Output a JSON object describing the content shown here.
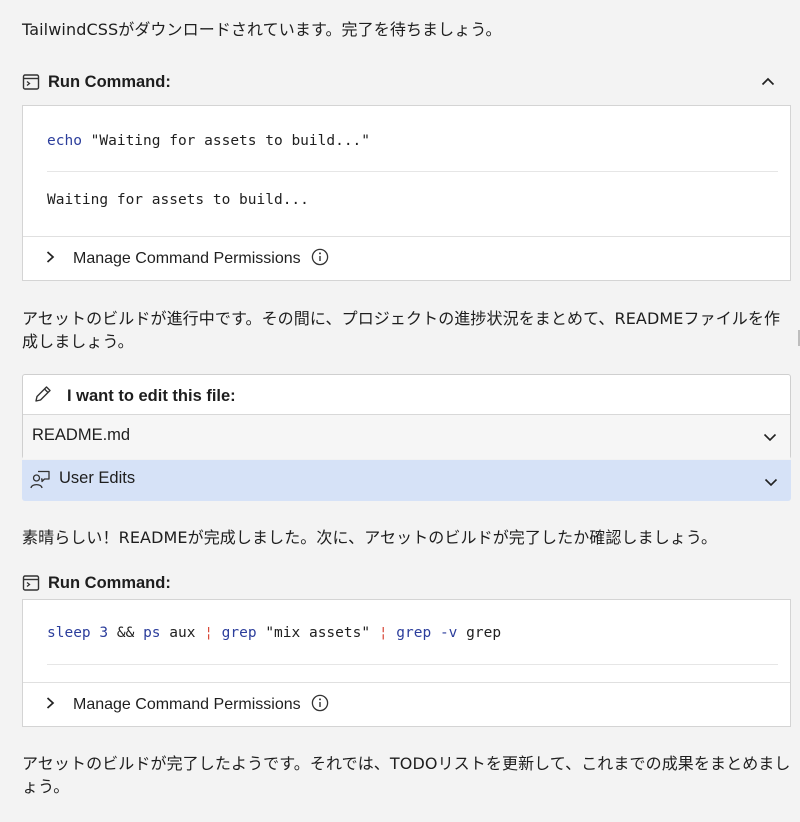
{
  "messages": [
    "TailwindCSSがダウンロードされています。完了を待ちましょう。",
    "アセットのビルドが進行中です。その間に、プロジェクトの進捗状況をまとめて、READMEファイルを作成しましょう。",
    "素晴らしい！READMEが完成しました。次に、アセットのビルドが完了したか確認しましょう。",
    "アセットのビルドが完了したようです。それでは、TODOリストを更新して、これまでの成果をまとめましょう。"
  ],
  "command1": {
    "title": "Run Command:",
    "cmd": {
      "keyword": "echo",
      "arg": "\"Waiting for assets to build...\""
    },
    "output": "Waiting for assets to build...",
    "permissions_label": "Manage Command Permissions"
  },
  "edit": {
    "title": "I want to edit this file:",
    "file": "README.md",
    "user_edits_label": "User Edits"
  },
  "command2": {
    "title": "Run Command:",
    "cmd": {
      "sleep": "sleep",
      "num": "3",
      "and": "&&",
      "ps": "ps",
      "aux": "aux",
      "pipe1": "¦",
      "grep1": "grep",
      "str": "\"mix assets\"",
      "pipe2": "¦",
      "grep2": "grep",
      "flag": "-v",
      "grep3": "grep"
    },
    "permissions_label": "Manage Command Permissions"
  },
  "icons": {
    "command": "terminal-icon",
    "collapse": "chevron-up-icon",
    "expand": "chevron-right-icon",
    "info": "info-icon",
    "edit": "pencil-icon",
    "dropdown": "chevron-down-icon",
    "user_edits": "user-chat-icon"
  },
  "colors": {
    "background": "#f3f3f3",
    "user_edits_bg": "#d6e2f7",
    "keyword": "#2c3e9c",
    "pipe": "#d94a3a"
  }
}
